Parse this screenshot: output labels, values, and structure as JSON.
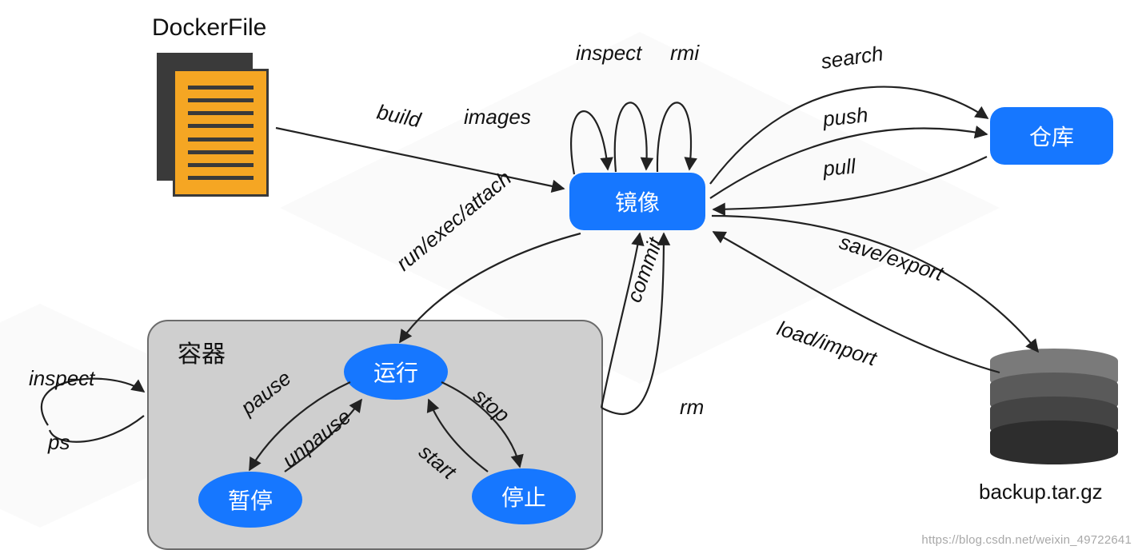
{
  "title": "DockerFile",
  "watermark": "https://blog.csdn.net/weixin_49722641",
  "nodes": {
    "image": "镜像",
    "repo": "仓库",
    "running": "运行",
    "paused": "暂停",
    "stopped": "停止",
    "container_group": "容器",
    "backup": "backup.tar.gz"
  },
  "edges": {
    "build": "build",
    "images": "images",
    "inspect_img": "inspect",
    "rmi": "rmi",
    "search": "search",
    "push": "push",
    "pull": "pull",
    "save_export": "save/export",
    "load_import": "load/import",
    "run_exec_attach": "run/exec/attach",
    "commit": "commit",
    "pause": "pause",
    "unpause": "unpause",
    "stop": "stop",
    "start": "start",
    "inspect_ct": "inspect",
    "ps": "ps",
    "rm": "rm"
  }
}
